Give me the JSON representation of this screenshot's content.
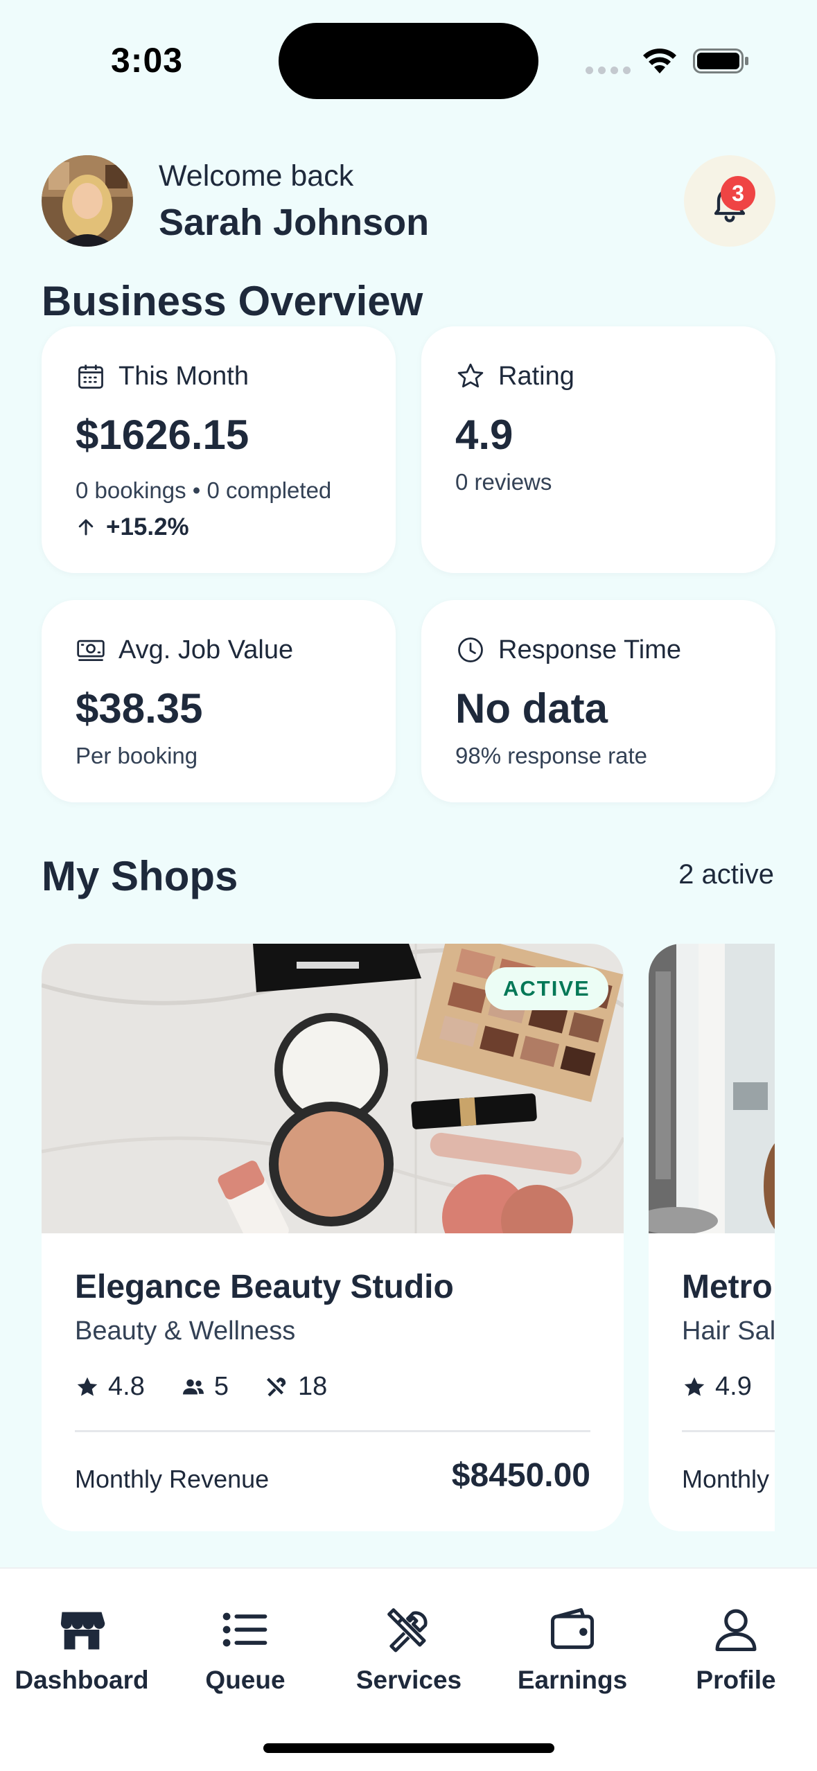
{
  "status_bar": {
    "time": "3:03"
  },
  "header": {
    "welcome": "Welcome back",
    "user_name": "Sarah Johnson",
    "notification_count": "3"
  },
  "overview": {
    "title": "Business Overview",
    "this_month": {
      "label": "This Month",
      "value": "$1626.15",
      "bookings": "0 bookings • 0 completed",
      "trend": "+15.2%",
      "icon": "calendar-icon"
    },
    "rating": {
      "label": "Rating",
      "value": "4.9",
      "sub": "0 reviews",
      "icon": "star-icon"
    },
    "avg_job": {
      "label": "Avg. Job Value",
      "value": "$38.35",
      "sub": "Per booking",
      "icon": "cash-icon"
    },
    "response": {
      "label": "Response Time",
      "value": "No data",
      "sub": "98% response rate",
      "icon": "clock-icon"
    }
  },
  "shops": {
    "title": "My Shops",
    "count": "2 active",
    "items": [
      {
        "badge": "ACTIVE",
        "name": "Elegance Beauty Studio",
        "category": "Beauty & Wellness",
        "rating": "4.8",
        "staff": "5",
        "services": "18",
        "revenue_label": "Monthly Revenue",
        "revenue": "$8450.00"
      },
      {
        "name": "Metro",
        "category": "Hair Sal",
        "rating": "4.9",
        "revenue_label": "Monthly"
      }
    ]
  },
  "tabs": [
    {
      "label": "Dashboard",
      "icon": "storefront-icon"
    },
    {
      "label": "Queue",
      "icon": "list-icon"
    },
    {
      "label": "Services",
      "icon": "tools-icon"
    },
    {
      "label": "Earnings",
      "icon": "wallet-icon"
    },
    {
      "label": "Profile",
      "icon": "person-icon"
    }
  ],
  "colors": {
    "background": "#effcfc",
    "text": "#1e293b",
    "badge_red": "#ef4444",
    "active_green": "#047857"
  }
}
